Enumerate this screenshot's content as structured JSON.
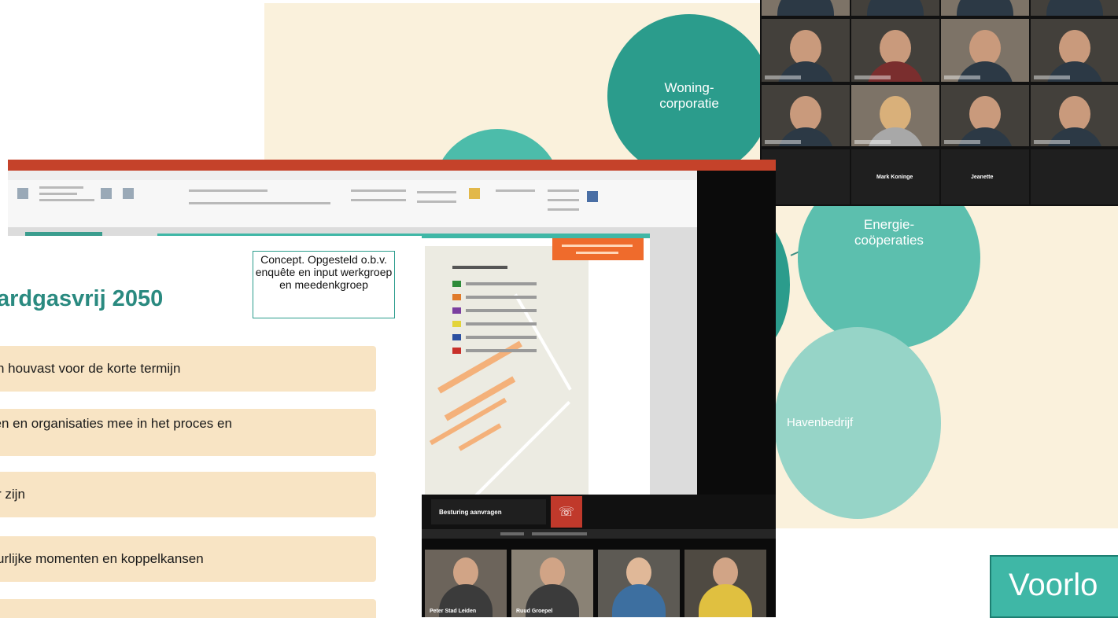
{
  "stakeholders": {
    "circle_woning": "Woning-\ncorporatie",
    "circle_energie": "Energie-\ncoöperaties",
    "circle_haven": "Havenbedrijf"
  },
  "badge": {
    "text": "Voorlo"
  },
  "video_grid": {
    "names": [
      "Mark Koninge",
      "Jeanette"
    ]
  },
  "share": {
    "request_control_label": "Besturing aanvragen",
    "participants": [
      "Peter Stad Leiden",
      "Ruud Groepel"
    ]
  },
  "front_slide": {
    "title": "ardgasvrij 2050",
    "concept_note": "Concept. Opgesteld o.b.v. enquête en input werkgroep en meedenkgroep",
    "bullets": [
      "n houvast voor de korte termijn",
      "ven en organisaties mee in het proces en",
      "r zijn",
      "urlijke momenten en koppelkansen",
      ""
    ]
  },
  "colors": {
    "teal_dark": "#2b9c8c",
    "teal_light": "#96d4c7",
    "cream": "#faf1dc",
    "bullet_bg": "#f8e4c4",
    "office_red": "#c5422a",
    "hangup_red": "#c0392b"
  }
}
